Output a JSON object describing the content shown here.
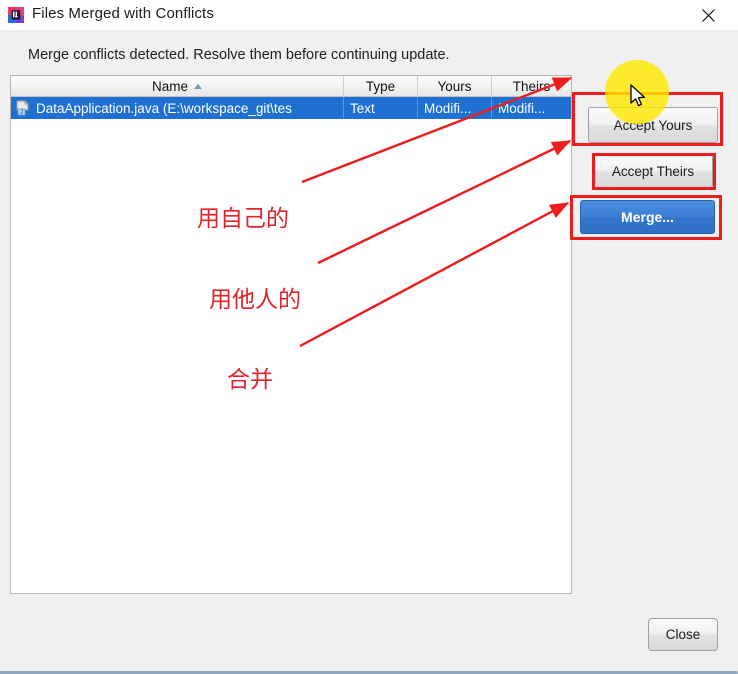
{
  "window": {
    "title": "Files Merged with Conflicts",
    "app_icon": "intellij-idea-icon",
    "close_icon": "close-icon"
  },
  "dialog": {
    "message": "Merge conflicts detected. Resolve them before continuing update."
  },
  "table": {
    "columns": [
      {
        "label": "Name",
        "sorted": "ascending",
        "sort_icon": "sort-ascending-icon"
      },
      {
        "label": "Type"
      },
      {
        "label": "Yours"
      },
      {
        "label": "Theirs"
      }
    ],
    "rows": [
      {
        "icon": "java-file-icon",
        "name": "DataApplication.java (E:\\workspace_git\\tes",
        "type": "Text",
        "yours": "Modifi...",
        "theirs": "Modifi...",
        "selected": true
      }
    ]
  },
  "buttons": {
    "accept_yours": "Accept Yours",
    "accept_theirs": "Accept Theirs",
    "merge": "Merge...",
    "close": "Close"
  },
  "annotations": {
    "accent_color": "#ee1c1c",
    "labels": [
      {
        "text": "用自己的",
        "points_to": "accept-yours-button"
      },
      {
        "text": "用他人的",
        "points_to": "accept-theirs-button"
      },
      {
        "text": "合并",
        "points_to": "merge-button"
      }
    ],
    "cursor_highlight_color": "#ffe800"
  },
  "colors": {
    "selection_blue": "#1f70d0",
    "default_button_blue": "#3b7fd6",
    "dialog_background": "#f0f0f0"
  }
}
